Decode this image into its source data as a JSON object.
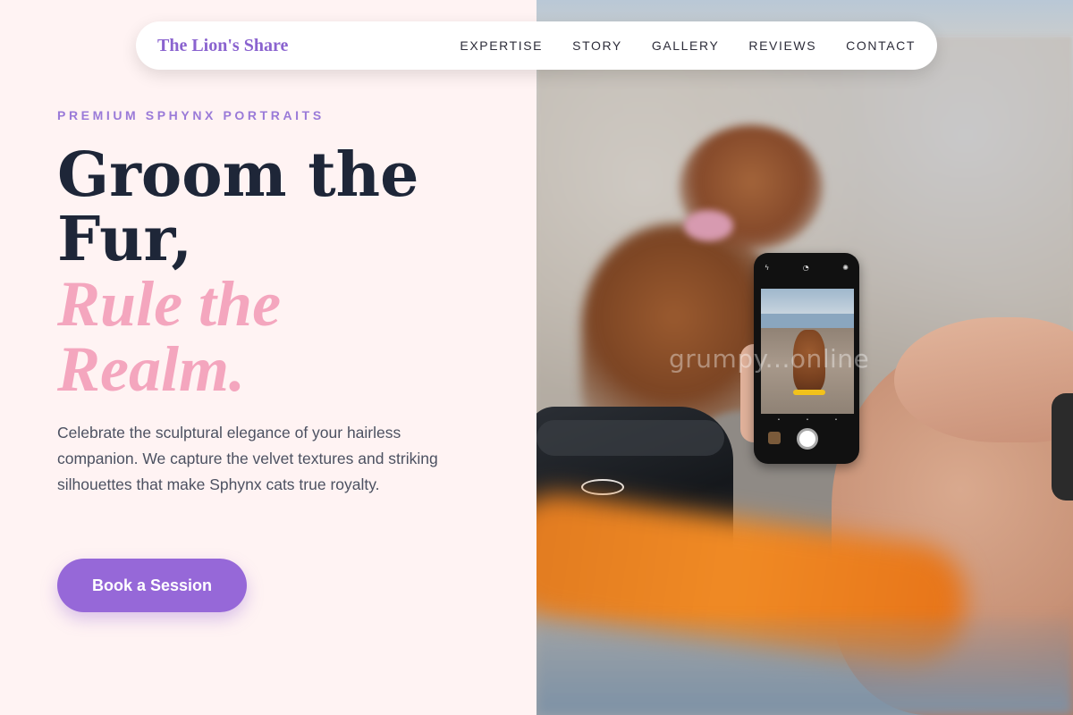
{
  "nav": {
    "brand": "The Lion's Share",
    "links": [
      "EXPERTISE",
      "STORY",
      "GALLERY",
      "REVIEWS",
      "CONTACT"
    ]
  },
  "hero": {
    "eyebrow": "PREMIUM SPHYNX PORTRAITS",
    "headline_line1": "Groom the",
    "headline_line2": "Fur,",
    "headline_accent1": "Rule the",
    "headline_accent2": "Realm.",
    "description": "Celebrate the sculptural elegance of your hairless companion. We capture the velvet textures and striking silhouettes that make Sphynx cats true royalty.",
    "cta_label": "Book a Session"
  },
  "image": {
    "watermark": "grumpy...online"
  },
  "colors": {
    "accent": "#9668d8",
    "brand": "#8a63cf",
    "headline": "#1e2638",
    "pink": "#f4a6be",
    "background": "#fff3f3"
  }
}
